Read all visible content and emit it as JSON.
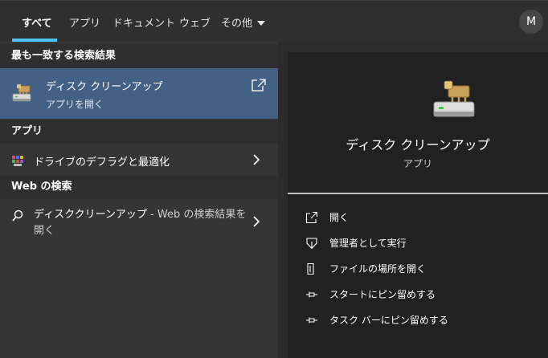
{
  "tabs": {
    "all": "すべて",
    "apps": "アプリ",
    "documents": "ドキュメント",
    "web": "ウェブ",
    "other": "その他"
  },
  "user": {
    "initial": "M"
  },
  "results": {
    "best_match_heading": "最も一致する検索結果",
    "best_match": {
      "title": "ディスク クリーンアップ",
      "subtitle": "アプリを開く",
      "icon": "disk-cleanup-icon"
    },
    "apps_heading": "アプリ",
    "apps": [
      {
        "label": "ドライブのデフラグと最適化",
        "icon": "defrag-icon"
      }
    ],
    "web_heading": "Web の検索",
    "web": {
      "query": "ディスククリーンアップ",
      "suffix": " - Web の検索結果を",
      "suffix2": "開く"
    }
  },
  "preview": {
    "title": "ディスク クリーンアップ",
    "subtitle": "アプリ",
    "actions": [
      {
        "label": "開く",
        "icon": "open-icon"
      },
      {
        "label": "管理者として実行",
        "icon": "shield-icon"
      },
      {
        "label": "ファイルの場所を開く",
        "icon": "file-location-icon"
      },
      {
        "label": "スタートにピン留めする",
        "icon": "pin-icon"
      },
      {
        "label": "タスク バーにピン留めする",
        "icon": "pin-icon"
      }
    ]
  },
  "colors": {
    "accent": "#4cc2ff",
    "selected_row": "#426184",
    "panel_left": "#353535",
    "panel_right": "#212121"
  }
}
